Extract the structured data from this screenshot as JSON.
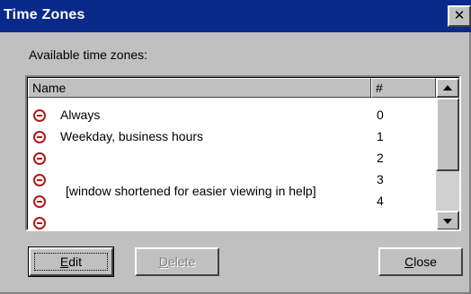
{
  "window": {
    "title": "Time Zones",
    "close_glyph": "✕"
  },
  "list_label": "Available time zones:",
  "columns": {
    "name": "Name",
    "number": "#"
  },
  "rows": [
    {
      "icon": "clock-icon",
      "name": "Always",
      "number": "0"
    },
    {
      "icon": "clock-icon",
      "name": "Weekday, business hours",
      "number": "1"
    },
    {
      "icon": "clock-icon",
      "name": "",
      "number": "2"
    },
    {
      "icon": "clock-icon",
      "name": "",
      "number": "3"
    },
    {
      "icon": "clock-icon",
      "name": "",
      "number": "4"
    }
  ],
  "note": "[window shortened for easier viewing in help]",
  "buttons": {
    "edit": {
      "mnemonic": "E",
      "rest": "dit"
    },
    "delete": {
      "mnemonic": "D",
      "rest": "elete"
    },
    "close": {
      "mnemonic": "C",
      "rest": "lose"
    }
  },
  "colors": {
    "titlebar": "#0a2a8a",
    "clock_icon": "#b01818"
  }
}
